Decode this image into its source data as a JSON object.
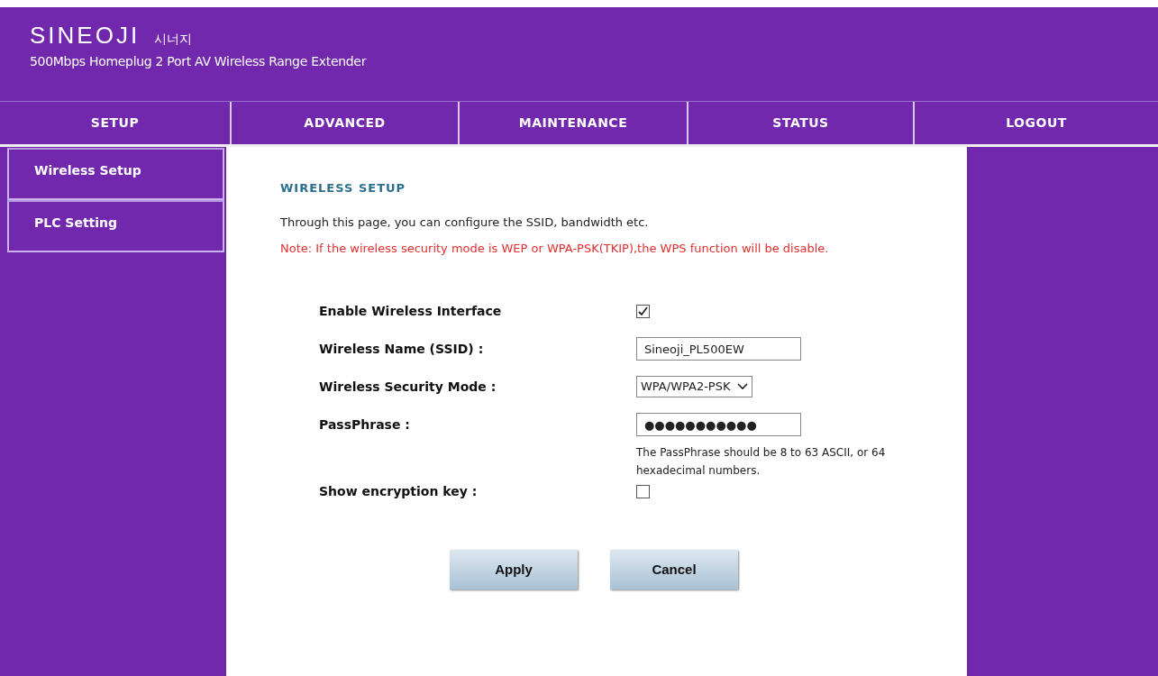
{
  "header": {
    "brand": "SINEOJI",
    "brand_korean": "시너지",
    "subtitle": "500Mbps Homeplug 2 Port AV Wireless Range Extender"
  },
  "nav": [
    "SETUP",
    "ADVANCED",
    "MAINTENANCE",
    "STATUS",
    "LOGOUT"
  ],
  "sidebar": {
    "items": [
      "Wireless Setup",
      "PLC Setting"
    ]
  },
  "content": {
    "title": "WIRELESS SETUP",
    "intro": "Through this page, you can configure the SSID, bandwidth etc.",
    "note": "Note: If the wireless security mode is WEP or WPA-PSK(TKIP),the WPS function will be disable.",
    "fields": [
      {
        "kind": "checkbox",
        "label": "Enable Wireless Interface",
        "checked": true
      },
      {
        "kind": "text",
        "label": "Wireless Name (SSID) :",
        "value": "Sineoji_PL500EW"
      },
      {
        "kind": "select",
        "label": "Wireless Security Mode :",
        "value": "WPA/WPA2-PSK"
      },
      {
        "kind": "text",
        "label": "PassPhrase :",
        "value": "●●●●●●●●●●●",
        "hint": "The PassPhrase should be 8 to 63 ASCII, or 64 hexadecimal numbers."
      },
      {
        "kind": "checkbox",
        "label": "Show encryption key :",
        "checked": false
      }
    ],
    "buttons": [
      "Apply",
      "Cancel"
    ]
  }
}
